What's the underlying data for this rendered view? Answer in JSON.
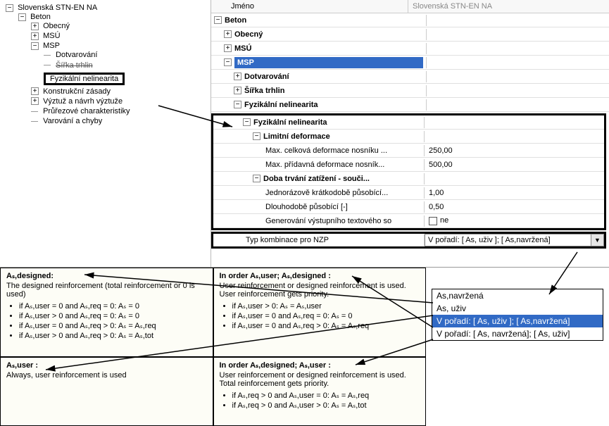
{
  "left_tree": {
    "root": "Slovenská STN-EN NA",
    "beton": "Beton",
    "obecny": "Obecný",
    "msu_upper": "MSÚ",
    "msp": "MSP",
    "dotvarovani": "Dotvarování",
    "sirka_struck": "Šířka trhlin",
    "fyz_nelin": "Fyzikální nelinearita",
    "konstr": "Konstrukční zásady",
    "vyztuz": "Výztuž a návrh výztuže",
    "prurez": "Průřezové charakteristiky",
    "varovani": "Varování a chyby"
  },
  "name_row": {
    "label": "Jméno",
    "value": "Slovenská STN-EN NA"
  },
  "prop_tree": {
    "beton": "Beton",
    "obecny": "Obecný",
    "msu": "MSÚ",
    "msp": "MSP",
    "dotvarovani": "Dotvarování",
    "sirka": "Šířka trhlin",
    "fyz1": "Fyzikální nelinearita",
    "fyz2": "Fyzikální nelinearita",
    "limitni": "Limitní deformace",
    "max_celkova_lbl": "Max. celková deformace nosníku ...",
    "max_celkova_val": "250,00",
    "max_pridavna_lbl": "Max. přídavná deformace nosník...",
    "max_pridavna_val": "500,00",
    "doba_lbl": "Doba trvání zatížení - souči...",
    "jedno_lbl": "Jednorázově krátkodobě působící...",
    "jedno_val": "1,00",
    "dlouho_lbl": "Dlouhodobě působící [-]",
    "dlouho_val": "0,50",
    "gener_lbl": "Generování výstupního textového so",
    "gener_val": "ne",
    "typ_komb_lbl": "Typ kombinace pro NZP",
    "typ_komb_val": "V pořadí: [ As, uživ ]; [ As,navržená]"
  },
  "dropdown": {
    "opt1": "As,navržená",
    "opt2": "As, uživ",
    "opt3": "V pořadí: [ As, uživ ]; [ As,navržená]",
    "opt4": "V pořadí: [ As, navržená]; [ As, uživ]"
  },
  "help": {
    "designed_title": "Aₛ,designed:",
    "designed_desc": "The designed reinforcement (total reinforcement or 0 is used)",
    "designed_b1": "if Aₛ,user = 0 and Aₛ,req = 0:  Aₛ = 0",
    "designed_b2": "if Aₛ,user > 0 and Aₛ,req = 0:  Aₛ = 0",
    "designed_b3": "if Aₛ,user = 0 and Aₛ,req > 0:  Aₛ = Aₛ,req",
    "designed_b4": "if Aₛ,user > 0 and Aₛ,req > 0:  Aₛ = Aₛ,tot",
    "user_title": "Aₛ,user :",
    "user_desc": "Always, user reinforcement is used",
    "ord_ud_title": "In order Aₛ,user; Aₛ,designed :",
    "ord_ud_desc": "User reinforcement or designed reinforcement is used.  User reinforcement gets priority.",
    "ord_ud_b1": "if Aₛ,user > 0:  Aₛ = Aₛ,user",
    "ord_ud_b2": "if Aₛ,user = 0 and Aₛ,req = 0:  Aₛ = 0",
    "ord_ud_b3": "if Aₛ,user = 0 and Aₛ,req > 0:  Aₛ = Aₛ,req",
    "ord_du_title": "In order Aₛ,designed; Aₛ,user :",
    "ord_du_desc": "User reinforcement or designed reinforcement is used.  Total reinforcement gets priority.",
    "ord_du_b1": "if Aₛ,req > 0 and Aₛ,user = 0:  Aₛ =  Aₛ,req",
    "ord_du_b2": "if Aₛ,req > 0 and Aₛ,user > 0:  Aₛ =  Aₛ,tot"
  }
}
